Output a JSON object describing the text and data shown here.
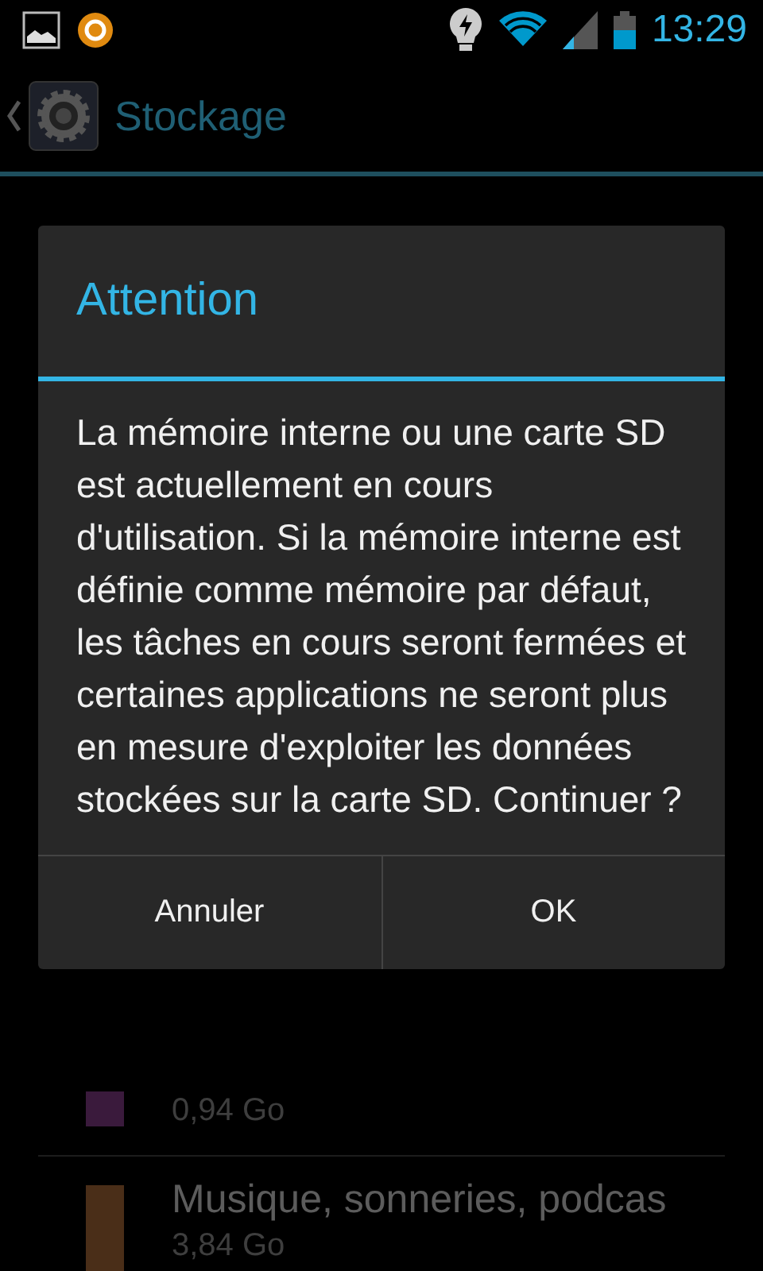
{
  "status_bar": {
    "time": "13:29"
  },
  "action_bar": {
    "title": "Stockage"
  },
  "storage": {
    "items": [
      {
        "color": "#3a1a3c",
        "size": "0,94 Go"
      },
      {
        "color": "#4a2e18",
        "label": "Musique, sonneries, podcas",
        "size": "3,84 Go"
      }
    ]
  },
  "dialog": {
    "title": "Attention",
    "message": "La mémoire interne ou une carte SD est actuellement en cours d'utilisation. Si la mémoire interne est définie comme mémoire par défaut, les tâches en cours seront fermées et certaines applications ne seront plus en mesure d'exploiter les données stockées sur la carte SD. Continuer ?",
    "buttons": [
      {
        "label": "Annuler"
      },
      {
        "label": "OK"
      }
    ]
  }
}
